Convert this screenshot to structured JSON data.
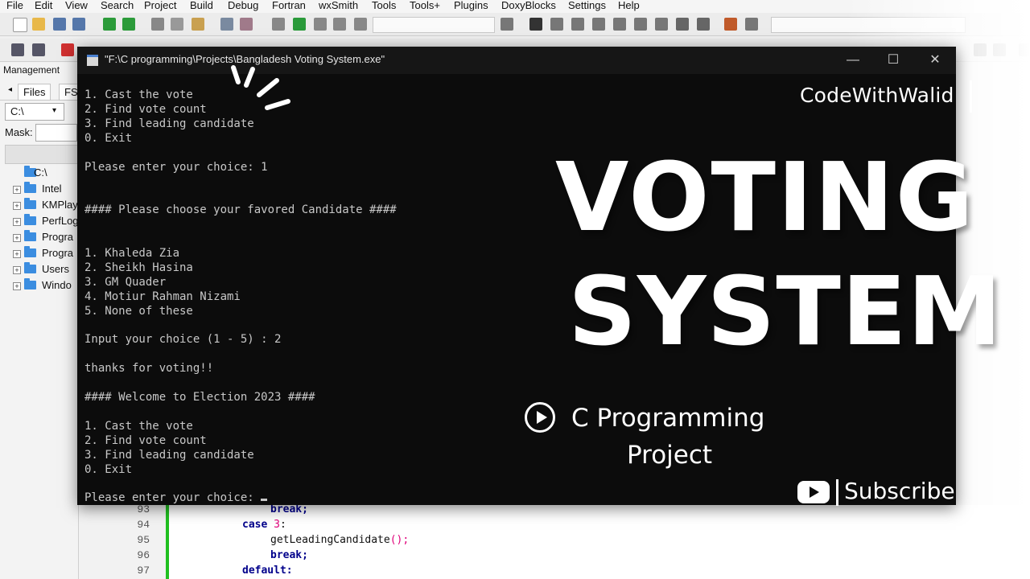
{
  "ide": {
    "menu": [
      "File",
      "Edit",
      "View",
      "Search",
      "Project",
      "Build",
      "Debug",
      "Fortran",
      "wxSmith",
      "Tools",
      "Tools+",
      "Plugins",
      "DoxyBlocks",
      "Settings",
      "Help"
    ],
    "management_title": "Management",
    "tab_files": "Files",
    "tab_fs": "FS",
    "drive_value": "C:\\",
    "mask_label": "Mask:",
    "tree": [
      "C:\\",
      "Intel",
      "KMPlay",
      "PerfLog",
      "Progra",
      "Progra",
      "Users",
      "Windo"
    ],
    "line_numbers": [
      "93",
      "94",
      "95",
      "96",
      "97"
    ],
    "code_lines": {
      "l93": "break;",
      "l94_kw": "case",
      "l94_num": "3",
      "l94_rest": ":",
      "l95": "getLeadingCandidate",
      "l95_paren": "();",
      "l96": "break;",
      "l97": "default:"
    }
  },
  "console": {
    "title": "\"F:\\C programming\\Projects\\Bangladesh Voting System.exe\"",
    "minimize": "—",
    "maximize": "☐",
    "close": "✕",
    "output": "1. Cast the vote\n2. Find vote count\n3. Find leading candidate\n0. Exit\n\nPlease enter your choice: 1\n\n\n#### Please choose your favored Candidate ####\n\n\n1. Khaleda Zia\n2. Sheikh Hasina\n3. GM Quader\n4. Motiur Rahman Nizami\n5. None of these\n\nInput your choice (1 - 5) : 2\n\nthanks for voting!!\n\n#### Welcome to Election 2023 ####\n\n1. Cast the vote\n2. Find vote count\n3. Find leading candidate\n0. Exit\n\nPlease enter your choice: "
  },
  "overlay": {
    "brand": "CodeWithWalid",
    "title_line1": "VOTING",
    "title_line2": "SYSTEM",
    "subtitle_line1": "C Programming",
    "subtitle_line2": "Project",
    "subscribe": "Subscribe"
  },
  "colors": {
    "console_bg": "#0c0c0c",
    "console_text": "#c8c8c8",
    "overlay_text": "#ffffff",
    "ide_bg": "#f0f0f0",
    "keyword": "#00008b",
    "number": "#e0007a",
    "diff_marker": "#20c020"
  }
}
